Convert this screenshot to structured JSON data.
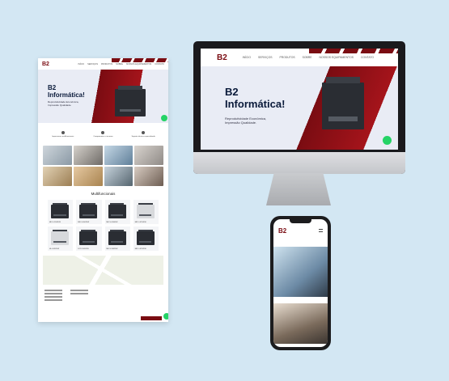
{
  "brand": {
    "logo": "B2",
    "accent": "#7a0c12"
  },
  "nav": {
    "links": [
      "INÍCIO",
      "SERVIÇOS",
      "PRODUTOS",
      "SOBRE",
      "NOSSOS EQUIPAMENTOS",
      "CONTATO"
    ]
  },
  "hero": {
    "title_line1": "B2",
    "title_line2": "Informática!",
    "subtitle_line1": "Reprodutividade Econômica,",
    "subtitle_line2": "Impressão Qualidade."
  },
  "features": [
    "Impressoras multifuncionais",
    "Componentes e insumos",
    "Suporte técnico especializado"
  ],
  "products_title": "Multifuncionais",
  "products": [
    "MFC-L5902DW",
    "MFC-L6902DW",
    "MFC-L6900DW",
    "MFC-L6700DW",
    "HL-L6202DW",
    "DCP-L5652DN",
    "MFC-L5802DW",
    "MFC-L6702DW"
  ],
  "footer_button": "Entre em contato",
  "whatsapp_icon": "whatsapp-icon"
}
